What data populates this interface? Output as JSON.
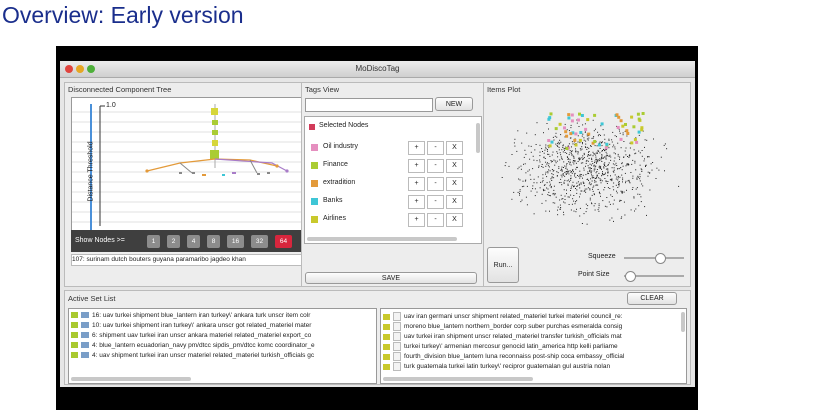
{
  "slide": {
    "title": "Overview: Early version"
  },
  "window": {
    "title": "MoDiscoTag"
  },
  "tree": {
    "label": "Disconnected Component Tree",
    "y_axis_label": "Distance Threshold",
    "top_value": "1.0",
    "show_nodes_label": "Show Nodes >=",
    "node_buttons": [
      "1",
      "2",
      "4",
      "8",
      "16",
      "32",
      "64"
    ],
    "selected_node_button": "64",
    "status": "107: surinam dutch bouters guyana paramaribo jagdeo khan"
  },
  "tags": {
    "label": "Tags View",
    "new_button": "NEW",
    "selected_nodes_label": "Selected Nodes",
    "items": [
      {
        "name": "Oil industry",
        "color": "#e58fbf"
      },
      {
        "name": "Finance",
        "color": "#aacc33"
      },
      {
        "name": "extradition",
        "color": "#e39a3a"
      },
      {
        "name": "Banks",
        "color": "#3ec6d6"
      },
      {
        "name": "Airlines",
        "color": "#c9c92c"
      }
    ],
    "plus": "+",
    "minus": "-",
    "close": "X",
    "save_button": "SAVE"
  },
  "plot": {
    "label": "Items Plot",
    "run_button": "Run...",
    "squeeze_label": "Squeeze",
    "point_size_label": "Point Size",
    "squeeze_level": 0.6,
    "point_size_level": 0.1
  },
  "active": {
    "label": "Active Set List",
    "clear_button": "CLEAR",
    "left_items": [
      "16: uav turkei shipment blue_lantern iran turkey\\' ankara turk unscr item colr",
      "10: uav turkei shipment iran turkey\\' ankara unscr got related_materiel mater",
      "6: shipment uav turkei iran unscr ankara materiel related_materiel export_co",
      "4: blue_lantern ecuadorian_navy pm/dtcc sipdis_pm/dtcc komc coordinator_e",
      "4: uav shipment turkei iran unscr materiel related_materiel turkish_officials gc"
    ],
    "right_items": [
      "uav iran germani unscr shipment related_materiel turkei materiel council_re:",
      "moreno blue_lantern northern_border corp suber purchas esmeralda consig",
      "uav turkei iran shipment unscr related_materiel transfer turkish_officials mat",
      "turkei turkey\\' armenian mercosur genocid latin_america http kelli parliame",
      "fourth_division blue_lantern luna reconnaiss post-ship coca embassy_official",
      "turk guatemala turkei latin turkey\\' recipror guatemalan gul austria nolan"
    ]
  },
  "colors": {
    "title_blue": "#1a2e8c",
    "selected_marker": "#d23b5a",
    "node_selected": "#d7263d",
    "folder_green": "#a9c92f",
    "folder_blue": "#7a9ec8"
  }
}
